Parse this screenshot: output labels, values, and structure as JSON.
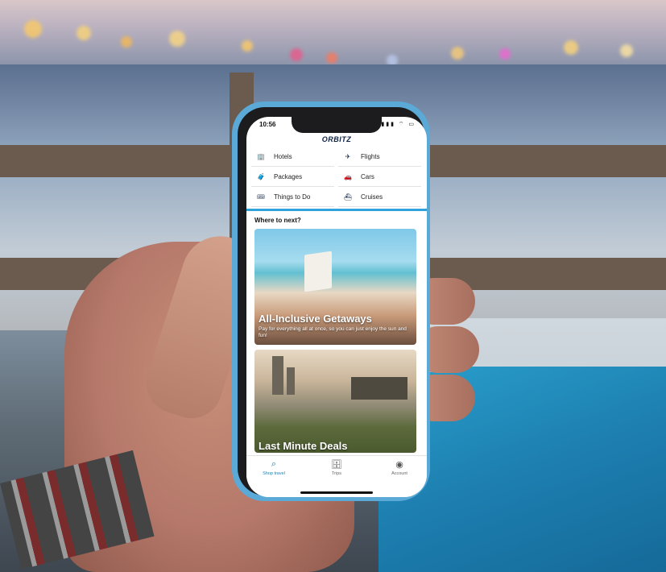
{
  "status": {
    "time": "10:56",
    "icons": "▮▮▮ ⌔ ▭"
  },
  "app": {
    "logo": "ORBITZ"
  },
  "menu": {
    "items": [
      {
        "label": "Hotels",
        "icon": "hotel-icon",
        "glyph": "🏢"
      },
      {
        "label": "Flights",
        "icon": "airplane-icon",
        "glyph": "✈"
      },
      {
        "label": "Packages",
        "icon": "package-icon",
        "glyph": "🧳"
      },
      {
        "label": "Cars",
        "icon": "car-icon",
        "glyph": "🚗"
      },
      {
        "label": "Things to Do",
        "icon": "ticket-icon",
        "glyph": "🎟"
      },
      {
        "label": "Cruises",
        "icon": "ship-icon",
        "glyph": "⛴"
      }
    ]
  },
  "main": {
    "heading": "Where to next?",
    "cards": [
      {
        "title": "All-Inclusive Getaways",
        "subtitle": "Pay for everything all at once, so you can just enjoy the sun and fun!"
      },
      {
        "title": "Last Minute Deals"
      }
    ]
  },
  "tabbar": {
    "tabs": [
      {
        "label": "Shop travel",
        "icon": "search-icon",
        "glyph": "⌕"
      },
      {
        "label": "Trips",
        "icon": "suitcase-icon",
        "glyph": "🗄"
      },
      {
        "label": "Account",
        "icon": "account-icon",
        "glyph": "◉"
      }
    ]
  },
  "colors": {
    "accent": "#2fa3db",
    "brand": "#0d2345",
    "case": "#5aa9d6"
  }
}
